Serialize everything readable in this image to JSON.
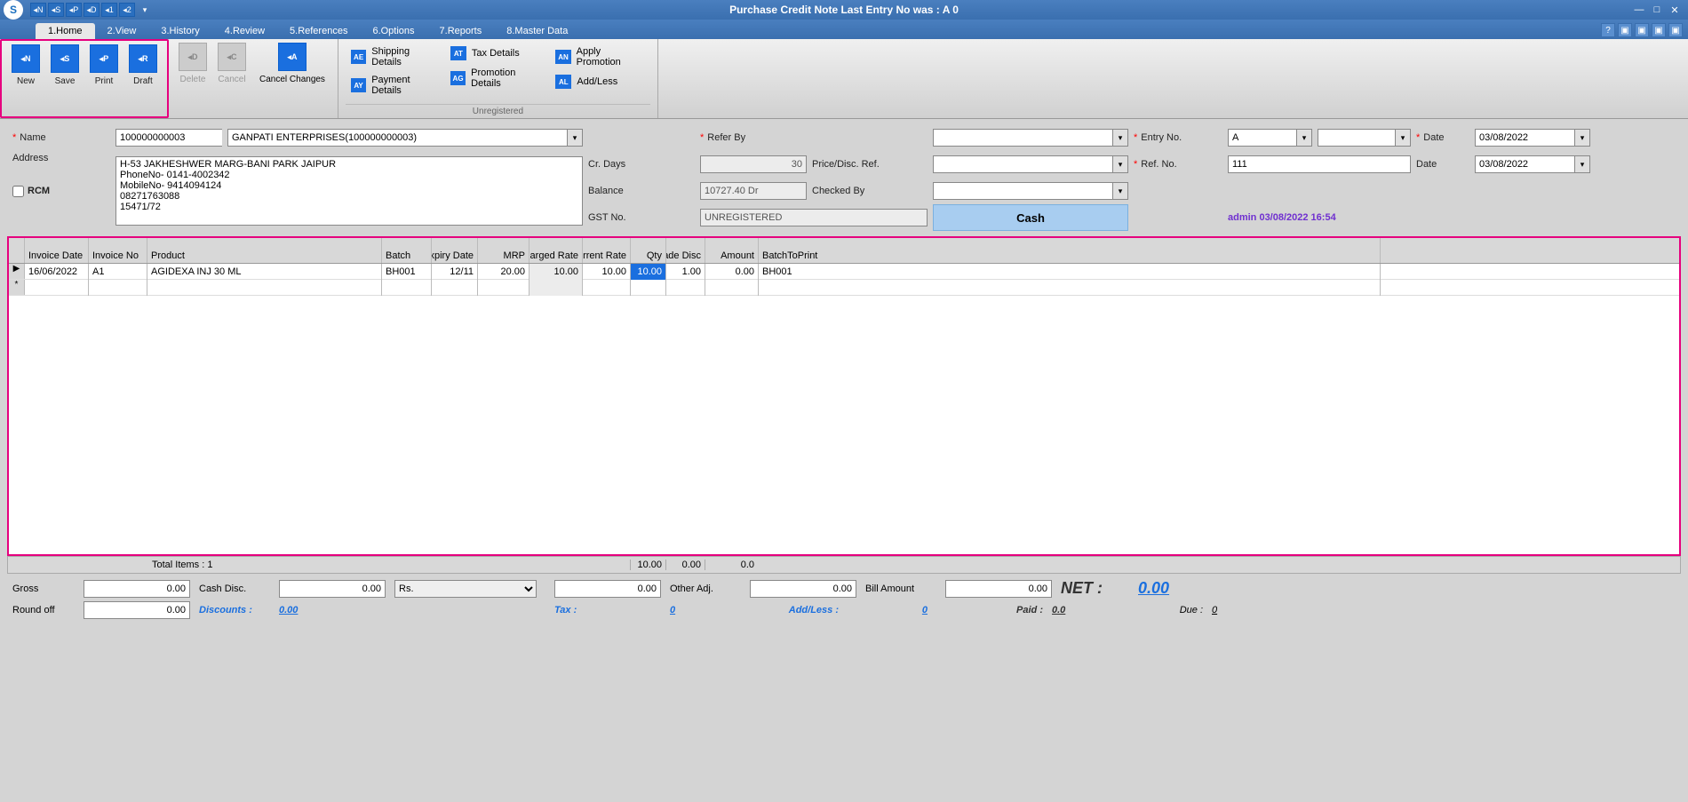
{
  "title": "Purchase Credit Note    Last Entry No was : A 0",
  "tabs": [
    "1.Home",
    "2.View",
    "3.History",
    "4.Review",
    "5.References",
    "6.Options",
    "7.Reports",
    "8.Master Data"
  ],
  "ribbon": {
    "new": "New",
    "save": "Save",
    "print": "Print",
    "draft": "Draft",
    "delete": "Delete",
    "cancel": "Cancel",
    "cancel_changes": "Cancel Changes",
    "shipping": "Shipping Details",
    "tax": "Tax Details",
    "apply_promo": "Apply Promotion",
    "payment": "Payment Details",
    "promo": "Promotion Details",
    "addless": "Add/Less",
    "group_caption": "Unregistered"
  },
  "form": {
    "name_label": "Name",
    "name_code": "100000000003",
    "name_full": "GANPATI ENTERPRISES(100000000003)",
    "address_label": "Address",
    "address": "H-53 JAKHESHWER MARG-BANI PARK JAIPUR\nPhoneNo- 0141-4002342\nMobileNo- 9414094124\n08271763088\n15471/72",
    "rcm_label": "RCM",
    "crdays_label": "Cr. Days",
    "crdays": "30",
    "balance_label": "Balance",
    "balance": "10727.40 Dr",
    "gstno_label": "GST No.",
    "gstno": "UNREGISTERED",
    "referby_label": "Refer By",
    "pricedisc_label": "Price/Disc. Ref.",
    "checkedby_label": "Checked By",
    "entryno_label": "Entry No.",
    "entry_series": "A",
    "refno_label": "Ref. No.",
    "refno": "111",
    "date_label": "Date",
    "date1": "03/08/2022",
    "date2": "03/08/2022",
    "cash": "Cash",
    "stamp": "admin 03/08/2022 16:54"
  },
  "grid": {
    "headers": {
      "invdate": "Invoice Date",
      "invno": "Invoice No",
      "product": "Product",
      "batch": "Batch",
      "expdate": "Expiry Date",
      "mrp": "MRP",
      "crate": "Charged Rate",
      "rate": "Current Rate",
      "qty": "Qty",
      "tdisc": "Trade Disc",
      "amount": "Amount",
      "btp": "BatchToPrint"
    },
    "rows": [
      {
        "invdate": "16/06/2022",
        "invno": "A1",
        "product": "AGIDEXA INJ 30 ML",
        "batch": "BH001",
        "expdate": "12/11",
        "mrp": "20.00",
        "crate": "10.00",
        "rate": "10.00",
        "qty": "10.00",
        "tdisc": "1.00",
        "amount": "0.00",
        "btp": "BH001"
      }
    ],
    "totals": {
      "label": "Total Items : 1",
      "qty": "10.00",
      "tdisc": "0.00",
      "amount": "0.0"
    }
  },
  "footer": {
    "gross_label": "Gross",
    "gross": "0.00",
    "roundoff_label": "Round off",
    "roundoff": "0.00",
    "cashdisc_label": "Cash Disc.",
    "cashdisc": "0.00",
    "cashdisc_unit": "Rs.",
    "discounts_label": "Discounts :",
    "discounts": "0.00",
    "otheradj_label": "Other Adj.",
    "otheradj": "0.00",
    "otheradj2": "0.00",
    "tax_label": "Tax :",
    "tax": "0",
    "addless_label": "Add/Less :",
    "addless": "0",
    "billamt_label": "Bill Amount",
    "billamt": "0.00",
    "paid_label": "Paid :",
    "paid": "0.0",
    "net_label": "NET :",
    "net": "0.00",
    "due_label": "Due :",
    "due": "0"
  }
}
